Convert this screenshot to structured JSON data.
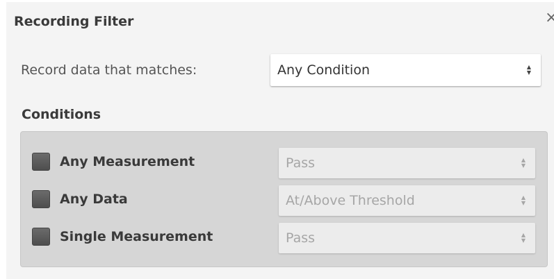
{
  "dialog": {
    "title": "Recording Filter",
    "close_glyph": "×"
  },
  "match": {
    "label": "Record data that matches:",
    "selected": "Any Condition"
  },
  "conditions": {
    "title": "Conditions",
    "rows": [
      {
        "label": "Any Measurement",
        "selected": "Pass",
        "checked": false
      },
      {
        "label": "Any Data",
        "selected": "At/Above Threshold",
        "checked": false
      },
      {
        "label": "Single Measurement",
        "selected": "Pass",
        "checked": false
      }
    ]
  },
  "icons": {
    "select_arrow_up": "▲",
    "select_arrow_down": "▼"
  },
  "colors": {
    "dialog_bg": "#f4f4f4",
    "conditions_bg": "#d6d6d6",
    "checkbox": "#5c5c5c",
    "disabled_text": "#a6a6a6"
  }
}
